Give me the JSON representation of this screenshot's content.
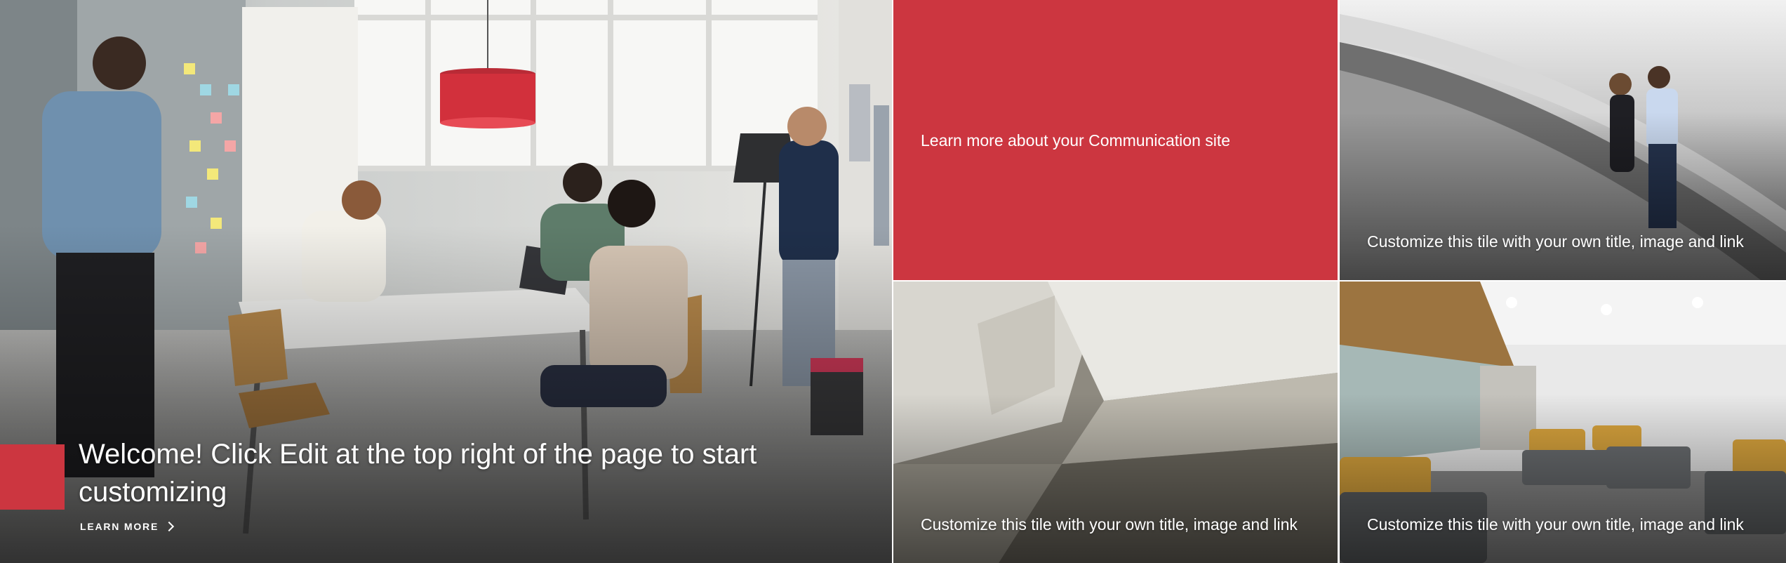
{
  "hero": {
    "main": {
      "title": "Welcome! Click Edit at the top right of the page to start customizing",
      "link_label": "LEARN MORE",
      "accent_color": "#cc3640"
    },
    "tiles": [
      {
        "caption": "Learn more about your Communication site",
        "background": "#cc3640"
      },
      {
        "caption": "Customize this tile with your own title, image and link"
      },
      {
        "caption": "Customize this tile with your own title, image and link"
      },
      {
        "caption": "Customize this tile with your own title, image and link"
      }
    ],
    "icons": {
      "link_arrow": "chevron-right-icon"
    }
  }
}
